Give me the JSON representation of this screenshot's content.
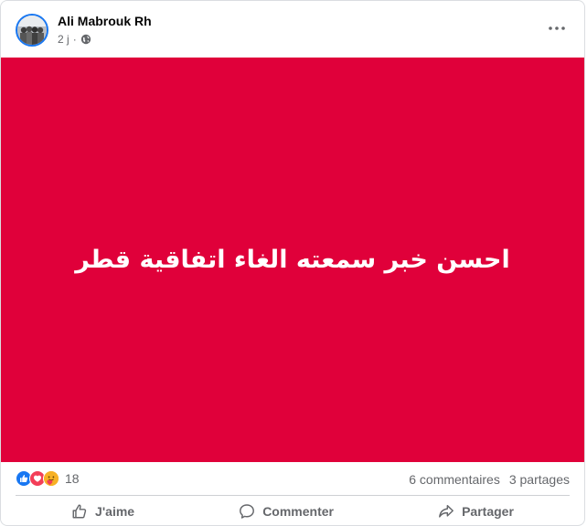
{
  "post": {
    "author": "Ali Mabrouk Rh",
    "time": "2 j",
    "separator": "·",
    "banner_text": "احسن خبر سمعته الغاء اتفاقية قطر",
    "banner_color": "#e0003a",
    "reactions": {
      "icons": [
        "like-icon",
        "love-icon",
        "care-icon"
      ],
      "count": "18"
    },
    "comments": "6 commentaires",
    "shares": "3 partages",
    "actions": {
      "like": "J'aime",
      "comment": "Commenter",
      "share": "Partager"
    }
  },
  "colors": {
    "like": "#1877f2",
    "love": "#f33e58",
    "care": "#f7b125",
    "muted_text": "#65676b"
  }
}
